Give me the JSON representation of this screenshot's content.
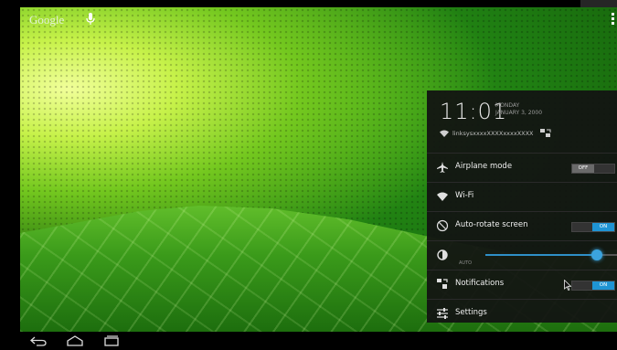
{
  "launcher": {
    "google_label": "Google"
  },
  "quick_settings": {
    "time": "11:01",
    "day": "MONDAY",
    "date": "JANUARY 3, 2000",
    "network_name": "linksysxxxxXXXXxxxxXXXX",
    "rows": [
      {
        "label": "Airplane mode",
        "icon": "airplane-icon",
        "toggle": "OFF"
      },
      {
        "label": "Wi-Fi",
        "icon": "wifi-icon"
      },
      {
        "label": "Auto-rotate screen",
        "icon": "rotate-icon",
        "toggle": "ON"
      },
      {
        "label": "Notifications",
        "icon": "notifications-icon",
        "toggle": "ON"
      },
      {
        "label": "Settings",
        "icon": "settings-sliders-icon"
      }
    ],
    "brightness": {
      "auto_label": "AUTO",
      "level": 0.85
    }
  },
  "colors": {
    "accent": "#1f94d4",
    "panel_bg": "#121212"
  }
}
